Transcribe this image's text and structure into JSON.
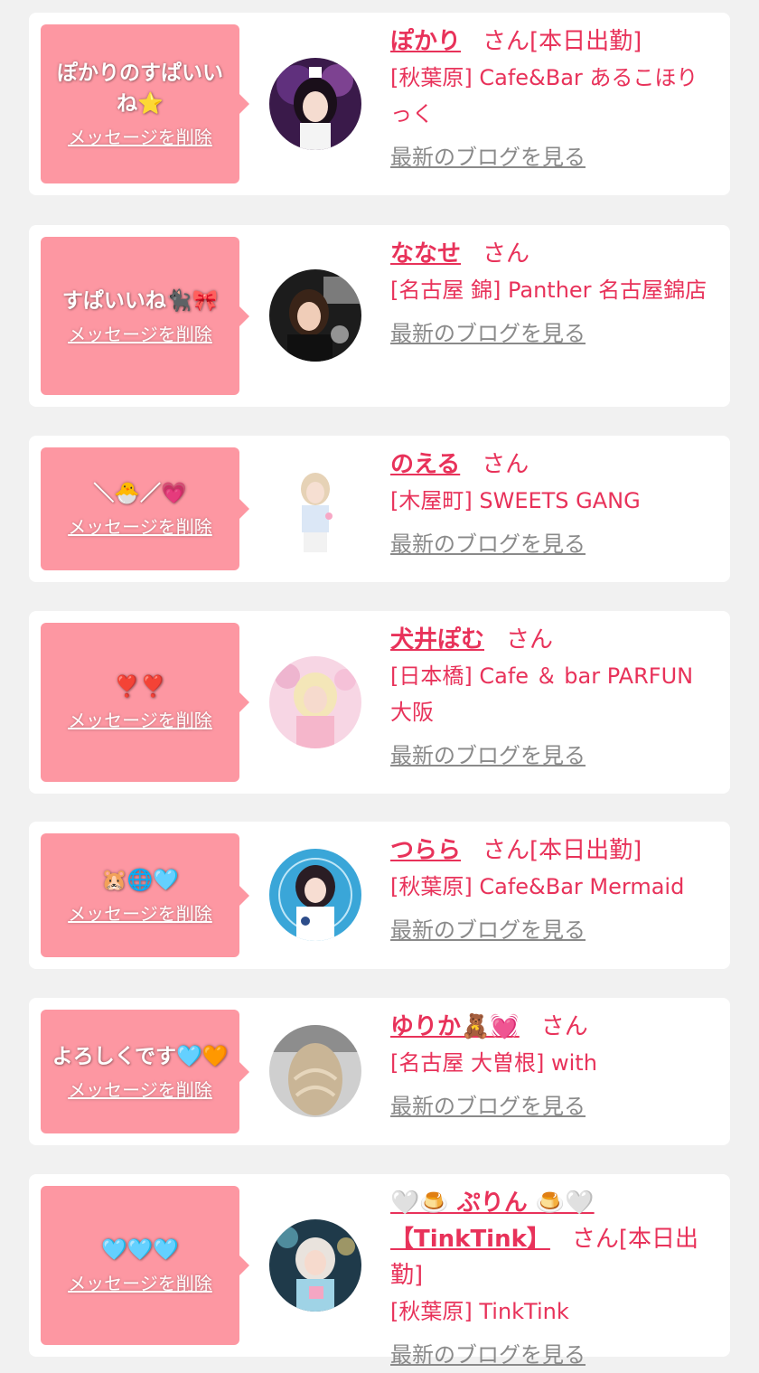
{
  "delete_label": "メッセージを削除",
  "blog_label": "最新のブログを見る",
  "san_label": "さん",
  "cards": [
    {
      "message": "ぽかりのすぱいいね⭐",
      "name": "ぽかり",
      "suffix": "さん[本日出勤]",
      "shop": "[秋葉原] Cafe&Bar あるこほりっく"
    },
    {
      "message": "すぱいいね🐈‍⬛🎀",
      "name": "ななせ",
      "suffix": "さん",
      "shop": "[名古屋 錦] Panther 名古屋錦店"
    },
    {
      "message": "＼🐣／💗",
      "name": "のえる",
      "suffix": "さん",
      "shop": "[木屋町] SWEETS GANG"
    },
    {
      "message": "❣️❣️",
      "name": "犬井ぽむ",
      "suffix": "さん",
      "shop": "[日本橋] Cafe ＆ bar PARFUN 大阪"
    },
    {
      "message": "🐹🌐🩵",
      "name": "つらら",
      "suffix": "さん[本日出勤]",
      "shop": "[秋葉原] Cafe&Bar Mermaid"
    },
    {
      "message": "よろしくです🩵🧡",
      "name": "ゆりか🧸💓",
      "suffix": "さん",
      "shop": "[名古屋 大曽根] with"
    },
    {
      "message": "🩵🩵🩵",
      "name": "🤍🍮 ぷりん 🍮🤍 【TinkTink】",
      "suffix": "さん[本日出勤]",
      "shop": "[秋葉原] TinkTink"
    }
  ],
  "colors": {
    "accent": "#e8325a",
    "bubble": "#fd97a2",
    "background": "#f1f1f1",
    "card": "#ffffff",
    "link_gray": "#8a8a8a"
  }
}
